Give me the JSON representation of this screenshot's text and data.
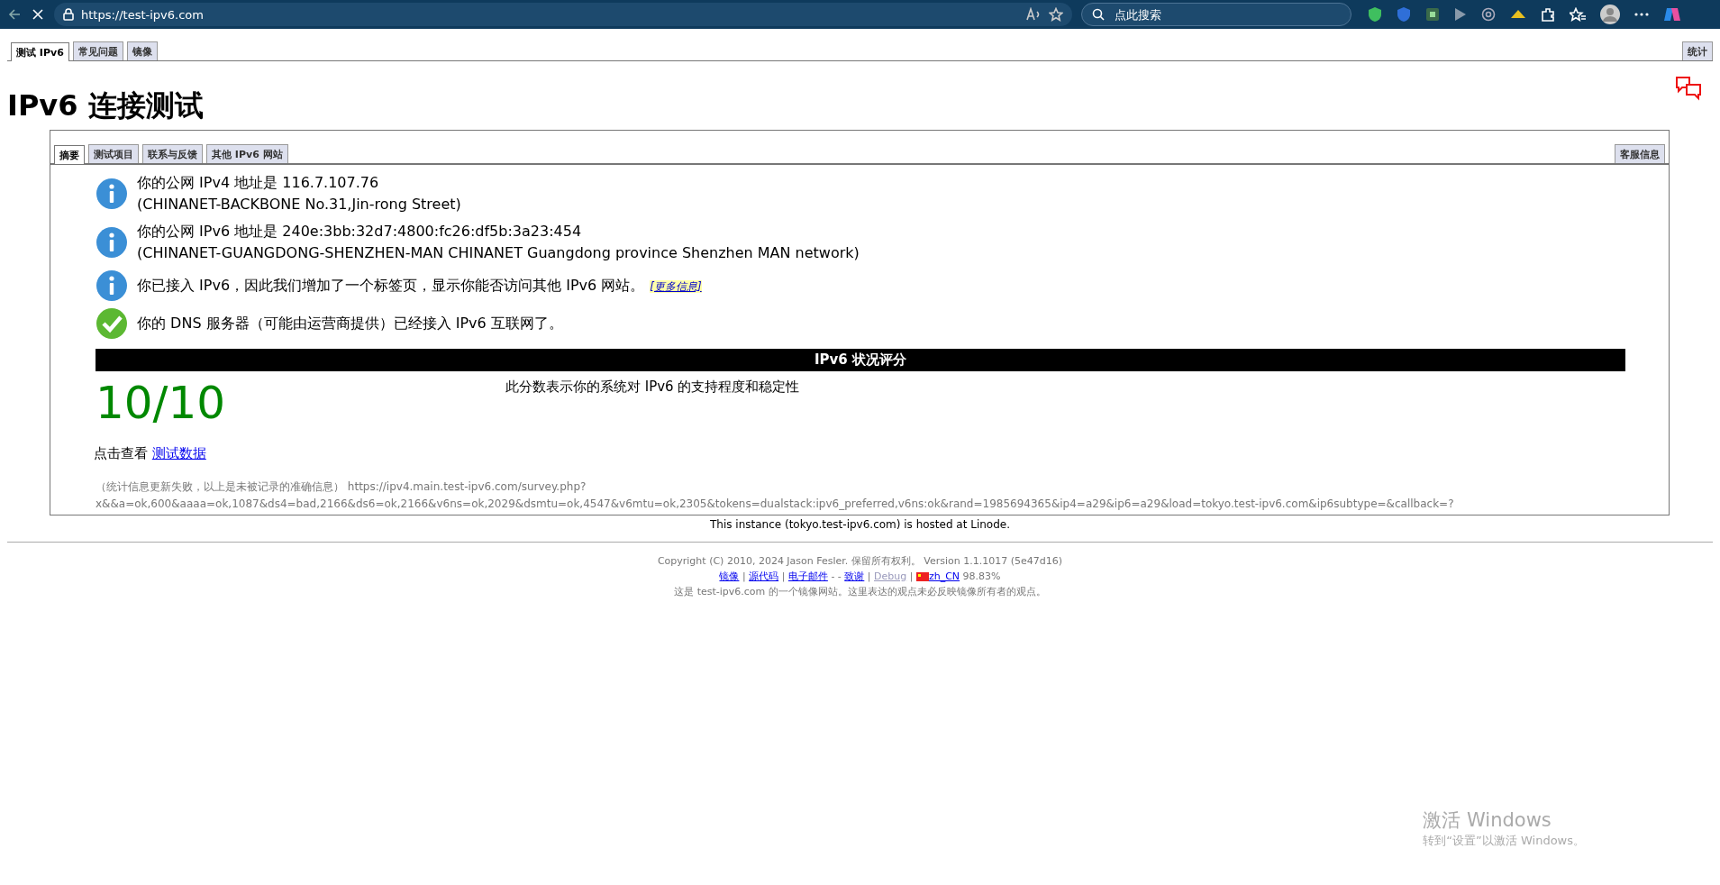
{
  "browser": {
    "url": "https://test-ipv6.com",
    "search_placeholder": "点此搜索"
  },
  "top_tabs": [
    {
      "label": "测试 IPv6",
      "selected": true
    },
    {
      "label": "常见问题",
      "selected": false
    },
    {
      "label": "镜像",
      "selected": false
    }
  ],
  "stats_tab": {
    "label": "统计",
    "selected": false
  },
  "title": "IPv6 连接测试",
  "inner_tabs": [
    {
      "label": "摘要",
      "selected": true
    },
    {
      "label": "测试项目",
      "selected": false
    },
    {
      "label": "联系与反馈",
      "selected": false
    },
    {
      "label": "其他 IPv6 网站",
      "selected": false
    }
  ],
  "support_tab": {
    "label": "客服信息",
    "selected": false
  },
  "results": [
    {
      "kind": "info",
      "lines": [
        "你的公网 IPv4 地址是 116.7.107.76",
        "(CHINANET-BACKBONE No.31,Jin-rong Street)"
      ]
    },
    {
      "kind": "info",
      "lines": [
        "你的公网 IPv6 地址是 240e:3bb:32d7:4800:fc26:df5b:3a23:454",
        "(CHINANET-GUANGDONG-SHENZHEN-MAN CHINANET Guangdong province Shenzhen MAN network)"
      ]
    },
    {
      "kind": "info",
      "lines": [
        "你已接入 IPv6，因此我们增加了一个标签页，显示你能否访问其他 IPv6 网站。"
      ],
      "link": "[更多信息]"
    },
    {
      "kind": "ok",
      "lines": [
        "你的 DNS 服务器（可能由运营商提供）已经接入 IPv6 互联网了。"
      ]
    }
  ],
  "score": {
    "heading": "IPv6 状况评分",
    "value": "10/10",
    "description": "此分数表示你的系统对 IPv6 的支持程度和稳定性"
  },
  "details": {
    "prefix": "点击查看",
    "link": "测试数据"
  },
  "survey_note": [
    "（统计信息更新失败，以上是未被记录的准确信息） https://ipv4.main.test-ipv6.com/survey.php?",
    "x&&a=ok,600&aaaa=ok,1087&ds4=bad,2166&ds6=ok,2166&v6ns=ok,2029&dsmtu=ok,4547&v6mtu=ok,2305&tokens=dualstack:ipv6_preferred,v6ns:ok&rand=1985694365&ip4=a29&ip6=a29&load=tokyo.test-ipv6.com&ip6subtype=&callback=?"
  ],
  "hosted": "This instance (tokyo.test-ipv6.com) is hosted at Linode.",
  "footer": {
    "copyright": "Copyright (C) 2010, 2024 Jason Fesler. 保留所有权利。 Version 1.1.1017 (5e47d16)",
    "links": [
      {
        "kind": "link",
        "text": "镜像"
      },
      {
        "kind": "sep",
        "text": "|"
      },
      {
        "kind": "link",
        "text": "源代码"
      },
      {
        "kind": "sep",
        "text": "|"
      },
      {
        "kind": "link",
        "text": "电子邮件"
      },
      {
        "kind": "text",
        "text": "-  -"
      },
      {
        "kind": "link",
        "text": "致谢"
      },
      {
        "kind": "sep",
        "text": "|"
      },
      {
        "kind": "faded_link",
        "text": "Debug"
      },
      {
        "kind": "sep",
        "text": "|"
      },
      {
        "kind": "flag_link",
        "text": "zh_CN"
      },
      {
        "kind": "text",
        "text": "98.83%"
      }
    ],
    "mirror_note": "这是 test-ipv6.com 的一个镜像网站。这里表达的观点未必反映镜像所有者的观点。"
  },
  "os_notice": {
    "title": "激活 Windows",
    "text": "转到“设置”以激活 Windows。"
  }
}
